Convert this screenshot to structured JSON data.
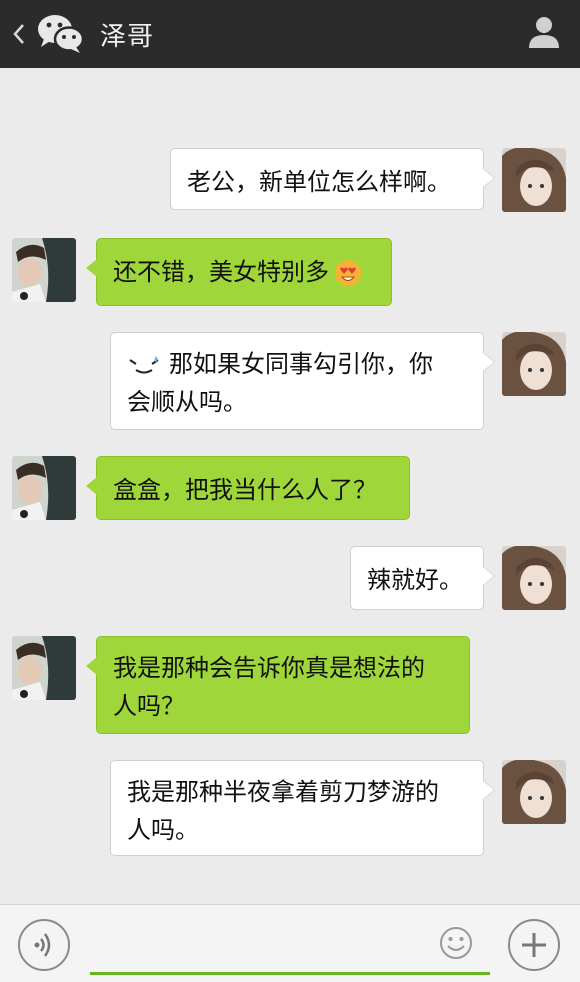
{
  "header": {
    "title": "泽哥",
    "back_icon": "chevron-left-icon",
    "app_icon": "wechat-icon",
    "profile_icon": "person-icon"
  },
  "messages": [
    {
      "side": "out",
      "text": "老公，新单位怎么样啊。"
    },
    {
      "side": "in",
      "text": "还不错，美女特别多",
      "emoji": "heart-eyes-emoji"
    },
    {
      "side": "out",
      "prefix_emoji": "sweat-emoji",
      "line1": "那如果女同事勾引你，你",
      "line2": "会顺从吗。"
    },
    {
      "side": "in",
      "text": "盒盒，把我当什么人了？"
    },
    {
      "side": "out",
      "text": "辣就好。"
    },
    {
      "side": "in",
      "line1": "我是那种会告诉你真是想法的",
      "line2": "人吗？"
    },
    {
      "side": "out",
      "line1": "我是那种半夜拿着剪刀梦游的",
      "line2": "人吗。"
    }
  ],
  "input_bar": {
    "voice_icon": "voice-icon",
    "input_value": "",
    "emoji_icon": "smiley-icon",
    "plus_icon": "plus-icon"
  },
  "colors": {
    "header_bg": "#2b2b2b",
    "chat_bg": "#ebebeb",
    "incoming_bubble": "#9fd63a",
    "outgoing_bubble": "#ffffff",
    "input_underline": "#67b51f"
  }
}
